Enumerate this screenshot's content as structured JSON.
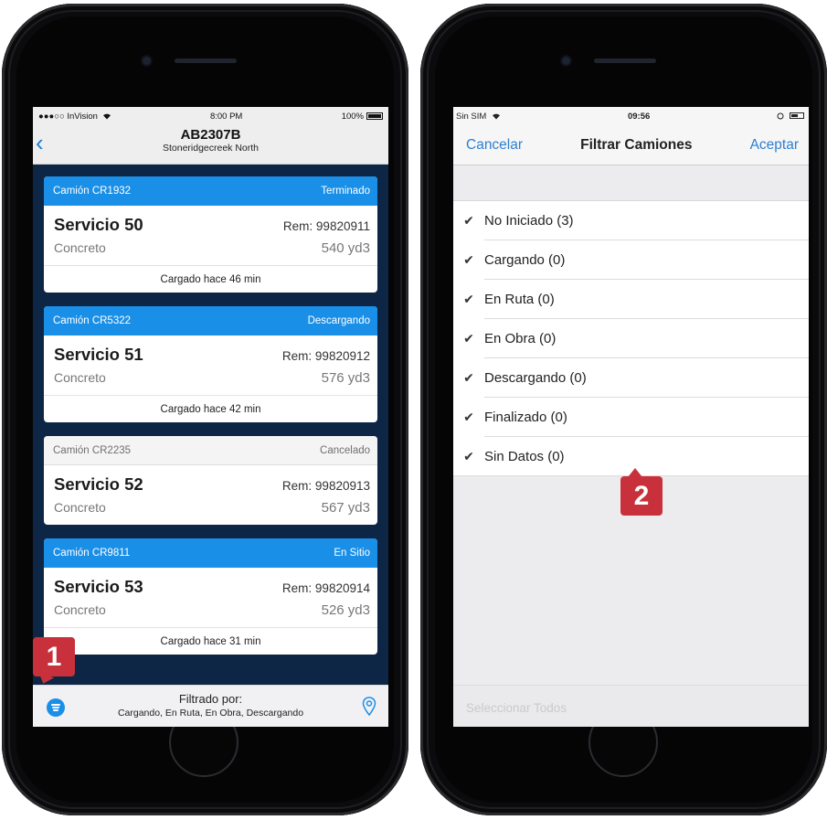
{
  "phone1": {
    "status": {
      "carrier": "●●●○○ InVision",
      "wifi": "wifi-icon",
      "time": "8:00 PM",
      "battery": "100%"
    },
    "nav": {
      "back": "‹",
      "title": "AB2307B",
      "subtitle": "Stoneridgecreek North"
    },
    "cards": [
      {
        "truck": "Camión CR1932",
        "status": "Terminado",
        "style": "blue",
        "service": "Servicio 50",
        "rem": "Rem: 99820911",
        "material": "Concreto",
        "volume": "540 yd3",
        "loaded": "Cargado hace 46 min"
      },
      {
        "truck": "Camión CR5322",
        "status": "Descargando",
        "style": "blue",
        "service": "Servicio 51",
        "rem": "Rem: 99820912",
        "material": "Concreto",
        "volume": "576 yd3",
        "loaded": "Cargado hace 42 min"
      },
      {
        "truck": "Camión CR2235",
        "status": "Cancelado",
        "style": "gray",
        "service": "Servicio 52",
        "rem": "Rem: 99820913",
        "material": "Concreto",
        "volume": "567 yd3"
      },
      {
        "truck": "Camión CR9811",
        "status": "En Sitio",
        "style": "blue",
        "service": "Servicio 53",
        "rem": "Rem: 99820914",
        "material": "Concreto",
        "volume": "526 yd3",
        "loaded": "Cargado hace 31 min"
      }
    ],
    "bottom": {
      "label": "Filtrado por:",
      "value": "Cargando, En Ruta, En Obra, Descargando",
      "filter_icon": "filter-icon",
      "map_icon": "map-pin-icon"
    }
  },
  "phone2": {
    "status": {
      "carrier": "Sin SIM",
      "wifi": "wifi-icon",
      "time": "09:56",
      "battery": "battery-icon"
    },
    "nav": {
      "cancel": "Cancelar",
      "title": "Filtrar Camiones",
      "accept": "Aceptar"
    },
    "options": [
      {
        "label": "No Iniciado (3)",
        "checked": true
      },
      {
        "label": "Cargando (0)",
        "checked": true
      },
      {
        "label": "En Ruta (0)",
        "checked": true
      },
      {
        "label": "En Obra (0)",
        "checked": true
      },
      {
        "label": "Descargando (0)",
        "checked": true
      },
      {
        "label": "Finalizado (0)",
        "checked": true
      },
      {
        "label": "Sin Datos (0)",
        "checked": true
      }
    ],
    "select_all": "Seleccionar Todos"
  },
  "callouts": [
    "1",
    "2"
  ],
  "colors": {
    "accent": "#1a8fe8",
    "link": "#2d7fd1",
    "callout": "#c8313b",
    "screen_bg": "#0d2645"
  }
}
